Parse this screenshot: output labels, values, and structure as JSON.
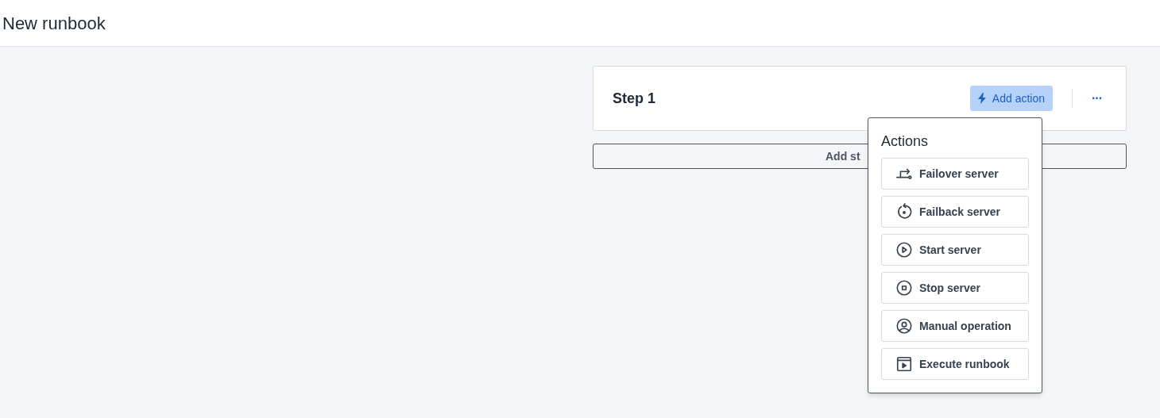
{
  "page": {
    "title": "New runbook"
  },
  "step": {
    "title": "Step 1",
    "add_action": {
      "label": "Add action",
      "active": true
    },
    "more": "···"
  },
  "add_step_button": {
    "label": "Add st"
  },
  "actions_menu": {
    "title": "Actions",
    "items": [
      {
        "kind": "failover",
        "label": "Failover server"
      },
      {
        "kind": "failback",
        "label": "Failback server"
      },
      {
        "kind": "start",
        "label": "Start server"
      },
      {
        "kind": "stop",
        "label": "Stop server"
      },
      {
        "kind": "manual",
        "label": "Manual operation"
      },
      {
        "kind": "execute",
        "label": "Execute runbook"
      }
    ]
  }
}
